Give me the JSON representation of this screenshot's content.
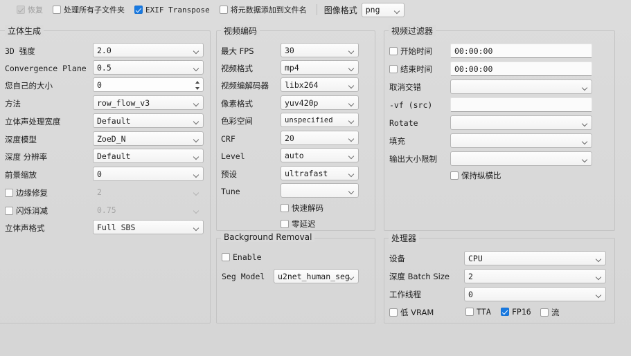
{
  "topbar": {
    "restore": {
      "label": "恢复",
      "checked": true,
      "disabled": true
    },
    "subfolders": {
      "label": "处理所有子文件夹",
      "checked": false
    },
    "exif": {
      "label": "EXIF Transpose",
      "checked": true
    },
    "metadata": {
      "label": "将元数据添加到文件名",
      "checked": false
    },
    "image_format_label": "图像格式",
    "image_format_value": "png"
  },
  "stereo": {
    "title": "立体生成",
    "rows": [
      {
        "label": "3D 强度",
        "value": "2.0",
        "type": "combo"
      },
      {
        "label": "Convergence Plane",
        "value": "0.5",
        "type": "combo"
      },
      {
        "label": "您自己的大小",
        "value": "0",
        "type": "spin"
      },
      {
        "label": "方法",
        "value": "row_flow_v3",
        "type": "combo"
      },
      {
        "label": "立体声处理宽度",
        "value": "Default",
        "type": "combo"
      },
      {
        "label": "深度模型",
        "value": "ZoeD_N",
        "type": "combo"
      },
      {
        "label": "深度 分辨率",
        "value": "Default",
        "type": "combo"
      },
      {
        "label": "前景缩放",
        "value": "0",
        "type": "combo"
      },
      {
        "label": "边缘修复",
        "value": "2",
        "type": "combo",
        "checkbox": true,
        "checked": false,
        "disabled": true
      },
      {
        "label": "闪烁消减",
        "value": "0.75",
        "type": "combo",
        "checkbox": true,
        "checked": false,
        "disabled": true
      },
      {
        "label": "立体声格式",
        "value": "Full SBS",
        "type": "combo"
      }
    ]
  },
  "video_encoding": {
    "title": "视频编码",
    "rows": [
      {
        "label": "最大 FPS",
        "value": "30"
      },
      {
        "label": "视频格式",
        "value": "mp4"
      },
      {
        "label": "视频编解码器",
        "value": "libx264"
      },
      {
        "label": "像素格式",
        "value": "yuv420p"
      },
      {
        "label": "色彩空间",
        "value": "unspecified"
      },
      {
        "label": "CRF",
        "value": "20"
      },
      {
        "label": "Level",
        "value": "auto"
      },
      {
        "label": "预设",
        "value": "ultrafast"
      },
      {
        "label": "Tune",
        "value": ""
      }
    ],
    "checks": [
      {
        "label": "快速解码",
        "checked": false
      },
      {
        "label": "零延迟",
        "checked": false
      }
    ]
  },
  "video_filters": {
    "title": "视频过滤器",
    "start_time": {
      "label": "开始时间",
      "value": "00:00:00",
      "checked": false
    },
    "end_time": {
      "label": "结束时间",
      "value": "00:00:00",
      "checked": false
    },
    "rows": [
      {
        "label": "取消交错",
        "value": "",
        "type": "combo"
      },
      {
        "label": "-vf (src)",
        "value": "",
        "type": "text"
      },
      {
        "label": "Rotate",
        "value": "",
        "type": "combo"
      },
      {
        "label": "填充",
        "value": "",
        "type": "combo"
      },
      {
        "label": "输出大小限制",
        "value": "",
        "type": "combo"
      }
    ],
    "keep_aspect": {
      "label": "保持纵横比",
      "checked": false
    }
  },
  "background_removal": {
    "title": "Background Removal",
    "enable": {
      "label": "Enable",
      "checked": false
    },
    "seg_model_label": "Seg Model",
    "seg_model_value": "u2net_human_seg"
  },
  "processor": {
    "title": "处理器",
    "rows": [
      {
        "label": "设备",
        "value": "CPU"
      },
      {
        "label": "深度 Batch Size",
        "value": "2"
      },
      {
        "label": "工作线程",
        "value": "0"
      }
    ],
    "checks": [
      {
        "label": "低 VRAM",
        "checked": false
      },
      {
        "label": "TTA",
        "checked": false
      },
      {
        "label": "FP16",
        "checked": true
      },
      {
        "label": "流",
        "checked": false
      }
    ]
  },
  "colors": {
    "accent": "#1879e0",
    "background": "#dadada",
    "border": "#c4c4c4",
    "text": "#1d1d1d",
    "disabled_text": "#a2a2a2"
  }
}
